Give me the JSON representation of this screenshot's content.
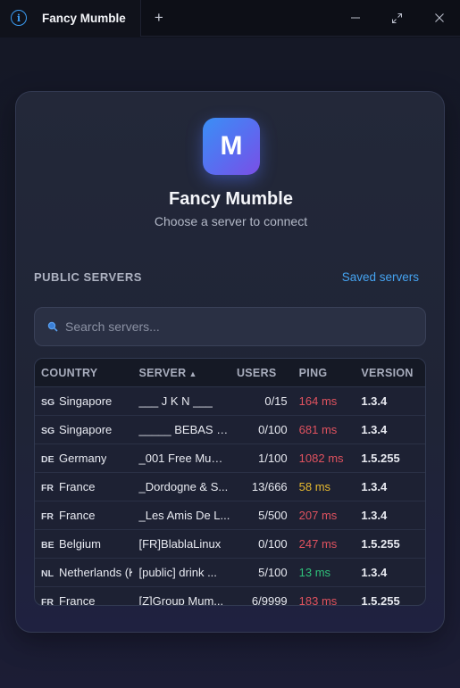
{
  "window": {
    "tab_title": "Fancy Mumble",
    "new_tab_symbol": "+",
    "minimize_symbol": "—",
    "maximize_symbol": "⤢",
    "close_symbol": "✕"
  },
  "header": {
    "logo_letter": "M",
    "app_name": "Fancy Mumble",
    "subtitle": "Choose a server to connect"
  },
  "section": {
    "title": "PUBLIC SERVERS",
    "saved_link": "Saved servers"
  },
  "search": {
    "placeholder": "Search servers..."
  },
  "table": {
    "columns": {
      "country": "COUNTRY",
      "server": "SERVER",
      "users": "USERS",
      "ping": "PING",
      "version": "VERSION"
    },
    "sort_indicator": "▲",
    "rows": [
      {
        "code": "SG",
        "country": "Singapore",
        "server": "___ J K N ___",
        "users": "0/15",
        "ping": "164 ms",
        "ping_color": "#e0525f",
        "version": "1.3.4"
      },
      {
        "code": "SG",
        "country": "Singapore",
        "server": "_____ BEBAS - ...",
        "users": "0/100",
        "ping": "681 ms",
        "ping_color": "#e0525f",
        "version": "1.3.4"
      },
      {
        "code": "DE",
        "country": "Germany",
        "server": "_001 Free Mum...",
        "users": "1/100",
        "ping": "1082 ms",
        "ping_color": "#e0525f",
        "version": "1.5.255"
      },
      {
        "code": "FR",
        "country": "France",
        "server": "_Dordogne & S...",
        "users": "13/666",
        "ping": "58 ms",
        "ping_color": "#e6b92f",
        "version": "1.3.4"
      },
      {
        "code": "FR",
        "country": "France",
        "server": "_Les Amis De L...",
        "users": "5/500",
        "ping": "207 ms",
        "ping_color": "#e0525f",
        "version": "1.3.4"
      },
      {
        "code": "BE",
        "country": "Belgium",
        "server": "[FR]BlablaLinux",
        "users": "0/100",
        "ping": "247 ms",
        "ping_color": "#e0525f",
        "version": "1.5.255"
      },
      {
        "code": "NL",
        "country": "Netherlands (K",
        "server": "[public] drink ...",
        "users": "5/100",
        "ping": "13 ms",
        "ping_color": "#2fc27a",
        "version": "1.3.4"
      },
      {
        "code": "FR",
        "country": "France",
        "server": "[Z]Group Mum...",
        "users": "6/9999",
        "ping": "183 ms",
        "ping_color": "#e0525f",
        "version": "1.5.255"
      }
    ]
  },
  "colors": {
    "accent": "#45a3f0",
    "ping_bad": "#e0525f",
    "ping_medium": "#e6b92f",
    "ping_good": "#2fc27a"
  }
}
